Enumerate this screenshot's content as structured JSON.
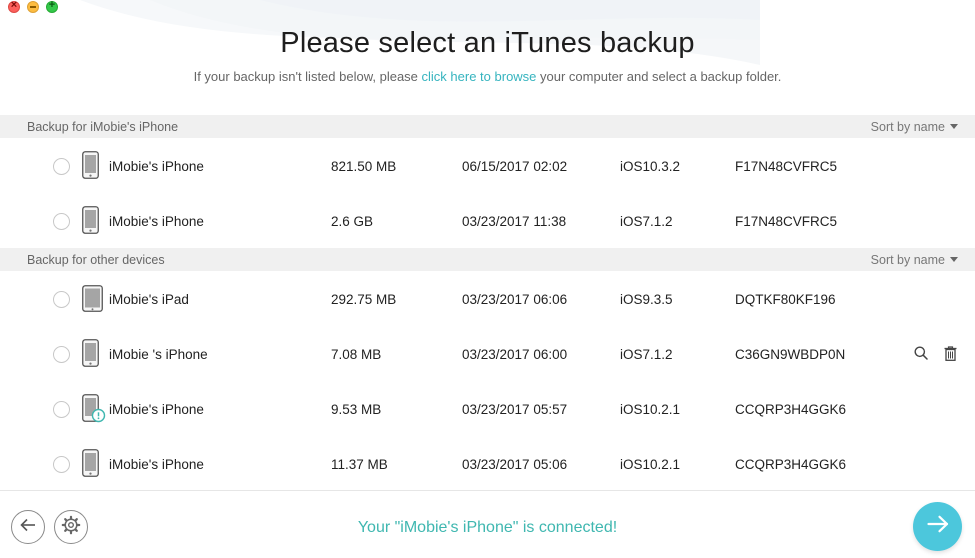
{
  "header": {
    "title": "Please select an iTunes backup",
    "subtitle_before": "If your backup isn't listed below, please ",
    "subtitle_link": "click here to browse",
    "subtitle_after": " your computer and select a backup folder."
  },
  "sections": [
    {
      "title": "Backup for iMobie's iPhone",
      "sort_label": "Sort by name",
      "rows": [
        {
          "name": "iMobie's iPhone",
          "size": "821.50 MB",
          "date": "06/15/2017 02:02",
          "ios": "iOS10.3.2",
          "serial": "F17N48CVFRC5",
          "device": "iphone-icon"
        },
        {
          "name": "iMobie's iPhone",
          "size": "2.6 GB",
          "date": "03/23/2017 11:38",
          "ios": "iOS7.1.2",
          "serial": "F17N48CVFRC5",
          "device": "iphone-icon"
        }
      ]
    },
    {
      "title": "Backup for other devices",
      "sort_label": "Sort by name",
      "rows": [
        {
          "name": "iMobie's iPad",
          "size": "292.75 MB",
          "date": "03/23/2017 06:06",
          "ios": "iOS9.3.5",
          "serial": "DQTKF80KF196",
          "device": "ipad-icon"
        },
        {
          "name": "iMobie 's iPhone",
          "size": "7.08 MB",
          "date": "03/23/2017 06:00",
          "ios": "iOS7.1.2",
          "serial": "C36GN9WBDP0N",
          "device": "iphone-icon"
        },
        {
          "name": "iMobie's iPhone",
          "size": "9.53 MB",
          "date": "03/23/2017 05:57",
          "ios": "iOS10.2.1",
          "serial": "CCQRP3H4GGK6",
          "device": "iphone-encrypted-icon"
        },
        {
          "name": "iMobie's iPhone",
          "size": "11.37 MB",
          "date": "03/23/2017 05:06",
          "ios": "iOS10.2.1",
          "serial": "CCQRP3H4GGK6",
          "device": "iphone-icon"
        }
      ]
    }
  ],
  "row_actions": [
    "search-icon",
    "trash-icon"
  ],
  "footer": {
    "status": "Your \"iMobie's iPhone\" is connected!",
    "back_icon": "arrow-left-icon",
    "settings_icon": "gear-icon",
    "next_icon": "arrow-right-icon"
  },
  "colors": {
    "accent": "#36b4bf",
    "status": "#3fb7b0",
    "next_button": "#4cc7dc",
    "section_bg": "#f0f0f0"
  }
}
